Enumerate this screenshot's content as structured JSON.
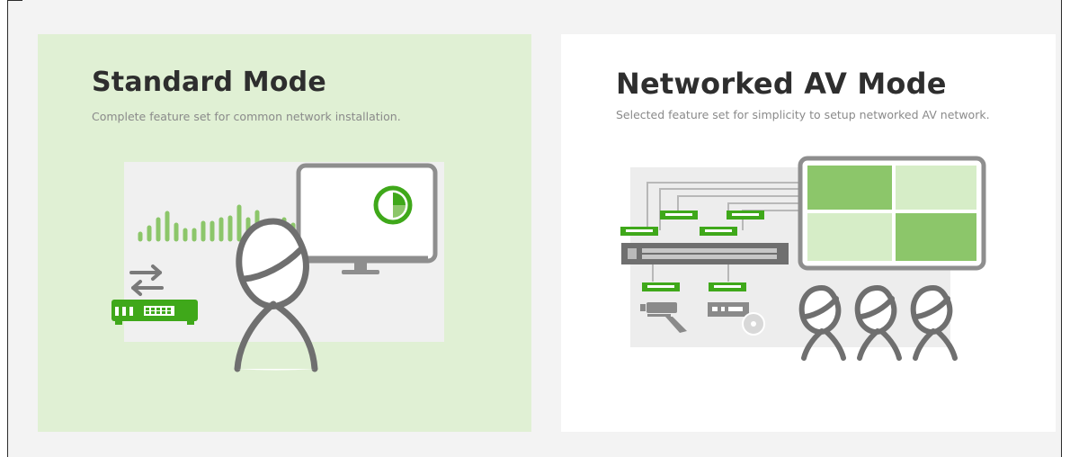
{
  "modes": [
    {
      "id": "standard",
      "title": "Standard Mode",
      "description": "Complete feature set for common network installation.",
      "selected": true
    },
    {
      "id": "networked_av",
      "title": "Networked AV Mode",
      "description": "Selected feature set for simplicity to setup networked AV network.",
      "selected": false
    }
  ],
  "colors": {
    "background": "#f3f3f3",
    "selected_card": "#e0f0d4",
    "card": "#ffffff",
    "accent_green": "#3fa81a",
    "light_green": "#8cc66a",
    "gray": "#6f6f6f",
    "title": "#2e2e2e",
    "description": "#8a8a8a"
  },
  "icons": {
    "standard": [
      "bar-chart-icon",
      "monitor-icon",
      "pie-chart-icon",
      "switch-icon",
      "exchange-arrows-icon",
      "person-icon"
    ],
    "networked_av": [
      "network-switch-icon",
      "video-wall-icon",
      "camera-icon",
      "media-player-icon",
      "people-icon"
    ]
  }
}
